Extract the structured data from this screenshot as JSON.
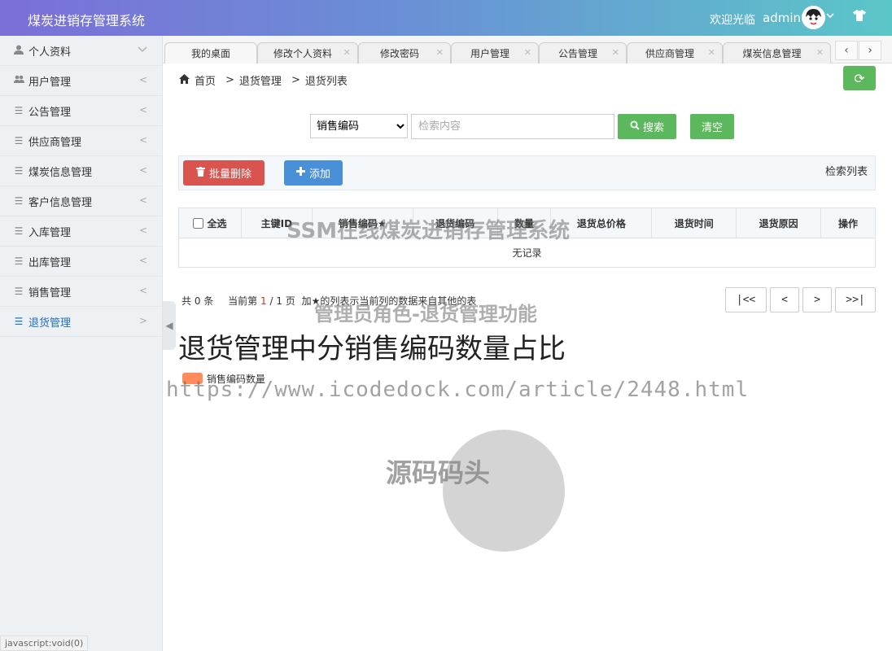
{
  "header": {
    "brand": "煤炭进销存管理系统",
    "welcome": "欢迎光临",
    "username": "admin"
  },
  "sidebar": {
    "items": [
      {
        "label": "个人资料",
        "icon": "user-icon",
        "arrow": "﹀"
      },
      {
        "label": "用户管理",
        "icon": "users-icon",
        "arrow": "<"
      },
      {
        "label": "公告管理",
        "icon": "list-icon",
        "arrow": "<"
      },
      {
        "label": "供应商管理",
        "icon": "list-icon",
        "arrow": "<"
      },
      {
        "label": "煤炭信息管理",
        "icon": "list-icon",
        "arrow": "<"
      },
      {
        "label": "客户信息管理",
        "icon": "list-icon",
        "arrow": "<"
      },
      {
        "label": "入库管理",
        "icon": "list-icon",
        "arrow": "<"
      },
      {
        "label": "出库管理",
        "icon": "list-icon",
        "arrow": "<"
      },
      {
        "label": "销售管理",
        "icon": "list-icon",
        "arrow": "<"
      },
      {
        "label": "退货管理",
        "icon": "list-icon",
        "arrow": ">"
      }
    ]
  },
  "status_url": "javascript:void(0)",
  "tabs": [
    {
      "label": "我的桌面"
    },
    {
      "label": "修改个人资料"
    },
    {
      "label": "修改密码"
    },
    {
      "label": "用户管理"
    },
    {
      "label": "公告管理"
    },
    {
      "label": "供应商管理"
    },
    {
      "label": "煤炭信息管理"
    }
  ],
  "breadcrumb": {
    "home": "首页",
    "sep": ">",
    "level1": "退货管理",
    "level2": "退货列表"
  },
  "search": {
    "field_selected": "销售编码",
    "placeholder": "检索内容",
    "search_label": "搜索",
    "clear_label": "清空"
  },
  "toolbar": {
    "batch_delete_label": "批量删除",
    "add_label": "添加",
    "panel_title": "检索列表"
  },
  "table": {
    "select_all_label": "全选",
    "columns": [
      "主键ID",
      "销售编码★",
      "退货编码",
      "数量",
      "退货总价格",
      "退货时间",
      "退货原因",
      "操作"
    ],
    "empty_text": "无记录"
  },
  "pagination": {
    "total_prefix": "共",
    "total": "0",
    "total_suffix": "条",
    "current_prefix": "当前第",
    "current": "1",
    "of": "/ 1 页",
    "note": "加★的列表示当前列的数据来自其他的表",
    "first": "|<<",
    "prev": "<",
    "next": ">",
    "last": ">>|"
  },
  "chart_data": {
    "type": "pie",
    "title": "退货管理中分销售编码数量占比",
    "legend": [
      "销售编码数量"
    ],
    "series": [
      {
        "name": "销售编码数量",
        "values": []
      }
    ],
    "colors": {
      "legend": "#ff8c5a",
      "empty_pie": "#d4d4d4"
    }
  },
  "watermarks": {
    "line1": "SSM在线煤炭进销存管理系统",
    "line2": "管理员角色-退货管理功能",
    "line3": "https://www.icodedock.com/article/2448.html",
    "line4": "源码码头"
  }
}
